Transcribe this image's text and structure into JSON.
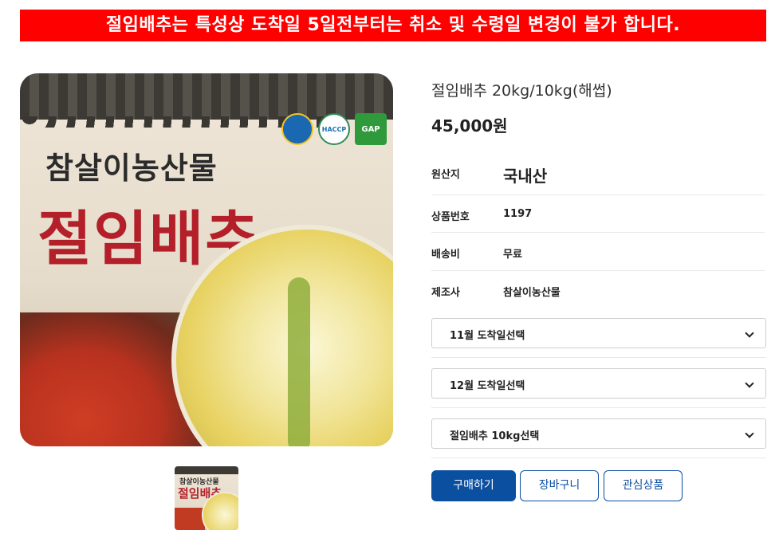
{
  "notice": "절임배추는 특성상 도착일 5일전부터는 취소 및 수령일 변경이 불가 합니다.",
  "image": {
    "brand_small": "참살이농산물",
    "brand_large": "절임배추",
    "badges": [
      "",
      "HACCP",
      "GAP"
    ]
  },
  "thumbnail": {
    "brand_small": "참살이농산물",
    "brand_large": "절임배추"
  },
  "product": {
    "name": "절임배추 20kg/10kg(해썹)",
    "price": "45,000원",
    "specs": [
      {
        "label": "원산지",
        "value": "국내산"
      },
      {
        "label": "상품번호",
        "value": "1197"
      },
      {
        "label": "배송비",
        "value": "무료"
      },
      {
        "label": "제조사",
        "value": "참살이농산물"
      }
    ],
    "options": [
      {
        "label": "11월 도착일선택"
      },
      {
        "label": "12월 도착일선택"
      },
      {
        "label": "절임배추 10kg선택"
      }
    ]
  },
  "buttons": {
    "buy": "구매하기",
    "cart": "장바구니",
    "wish": "관심상품"
  },
  "colors": {
    "notice_bg": "#ff0000",
    "primary": "#0b4fa1"
  }
}
